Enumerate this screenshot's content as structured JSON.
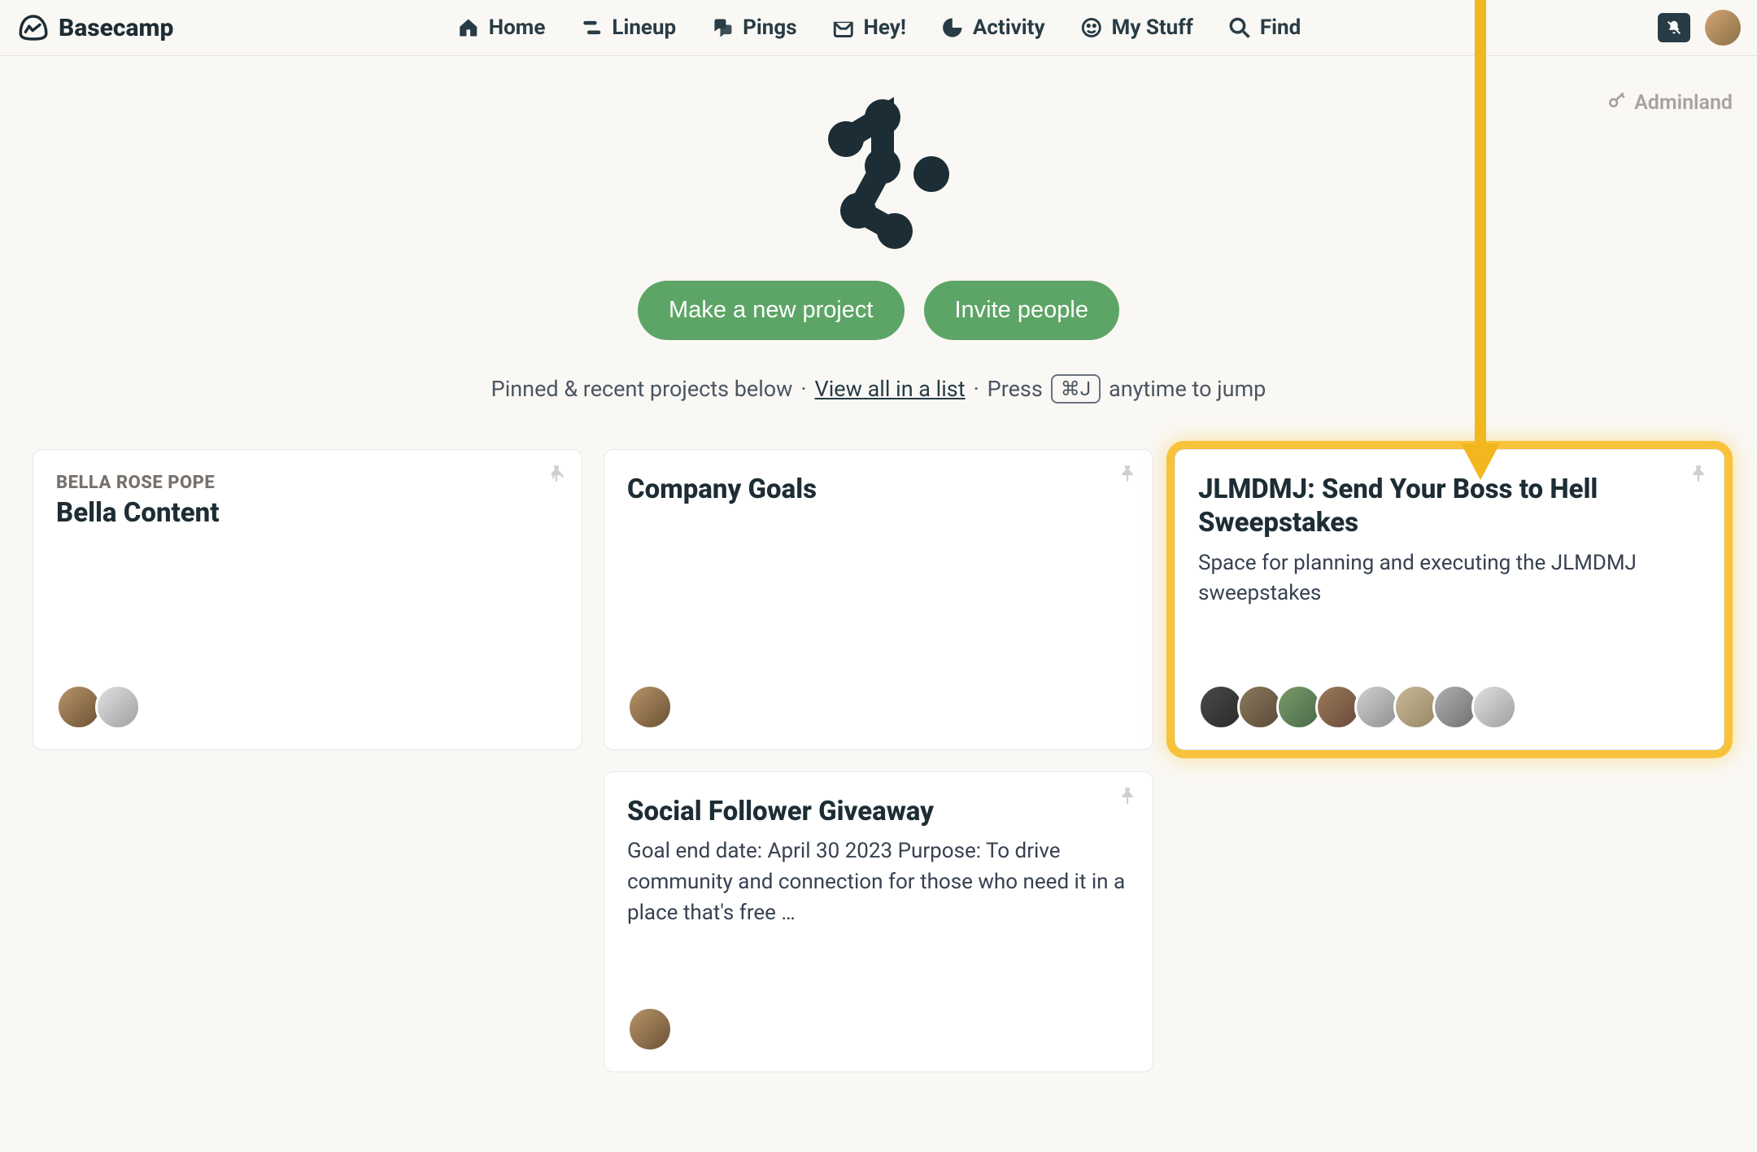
{
  "brand": "Basecamp",
  "nav": {
    "home": "Home",
    "lineup": "Lineup",
    "pings": "Pings",
    "hey": "Hey!",
    "activity": "Activity",
    "mystuff": "My Stuff",
    "find": "Find"
  },
  "adminland": "Adminland",
  "hero": {
    "make_project": "Make a new project",
    "invite_people": "Invite people"
  },
  "helper": {
    "pinned_text": "Pinned & recent projects below",
    "sep1": "·",
    "view_all": "View all in a list",
    "sep2": "·",
    "press": "Press",
    "shortcut": "⌘J",
    "jump": "anytime to jump"
  },
  "projects": [
    {
      "eyebrow": "BELLA ROSE POPE",
      "title": "Bella Content",
      "desc": "",
      "highlighted": false,
      "avatar_count": 2
    },
    {
      "eyebrow": "",
      "title": "Company Goals",
      "desc": "",
      "highlighted": false,
      "avatar_count": 1
    },
    {
      "eyebrow": "",
      "title": "JLMDMJ: Send Your Boss to Hell Sweepstakes",
      "desc": "Space for planning and executing the JLMDMJ sweepstakes",
      "highlighted": true,
      "avatar_count": 8
    },
    {
      "eyebrow": "",
      "title": "Social Follower Giveaway",
      "desc": "Goal end date: April 30 2023 Purpose: To drive community and connection for those who need it in a place that's free …",
      "highlighted": false,
      "avatar_count": 1
    }
  ]
}
